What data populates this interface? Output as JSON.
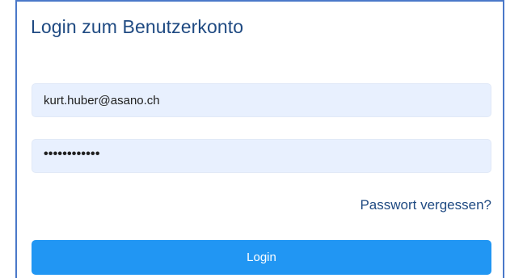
{
  "login_form": {
    "title": "Login zum Benutzerkonto",
    "email_value": "kurt.huber@asano.ch",
    "password_value": "••••••••••••",
    "forgot_password_label": "Passwort vergessen?",
    "login_button_label": "Login"
  },
  "colors": {
    "frame_border": "#4a78c9",
    "title_text": "#1f4a82",
    "input_background": "#e8f0fe",
    "link_text": "#1f4a82",
    "button_background": "#2196f3",
    "button_text": "#ffffff"
  }
}
